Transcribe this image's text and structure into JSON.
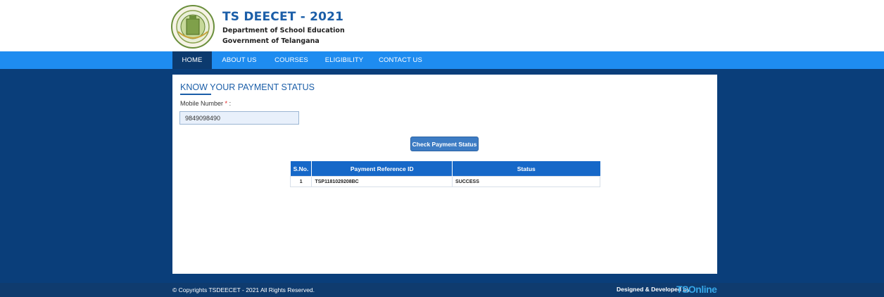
{
  "header": {
    "title": "TS DEECET - 2021",
    "department": "Department of School Education",
    "government": "Government of Telangana"
  },
  "nav": {
    "items": [
      {
        "label": "HOME",
        "active": true
      },
      {
        "label": "ABOUT US",
        "active": false
      },
      {
        "label": "COURSES",
        "active": false
      },
      {
        "label": "ELIGIBILITY",
        "active": false
      },
      {
        "label": "CONTACT US",
        "active": false
      }
    ]
  },
  "page": {
    "title": "KNOW YOUR PAYMENT STATUS",
    "mobile_label": "Mobile Number",
    "required_mark": "*",
    "label_colon": " :",
    "mobile_value": "9849098490",
    "check_button": "Check Payment Status"
  },
  "table": {
    "headers": [
      "S.No.",
      "Payment Reference ID",
      "Status"
    ],
    "rows": [
      [
        "1",
        "TSP1181029208BC",
        "SUCCESS"
      ]
    ]
  },
  "footer": {
    "copyright": "© Copyrights TSDEECET - 2021 All Rights Reserved.",
    "designed_by": "Designed & Developed by",
    "brand": "TSOnline"
  },
  "colors": {
    "brand_blue": "#1b5ea8",
    "nav_bar": "#1e8cf0",
    "nav_active": "#0c3a6e",
    "background": "#0a3e7a",
    "table_header": "#1668c8"
  }
}
